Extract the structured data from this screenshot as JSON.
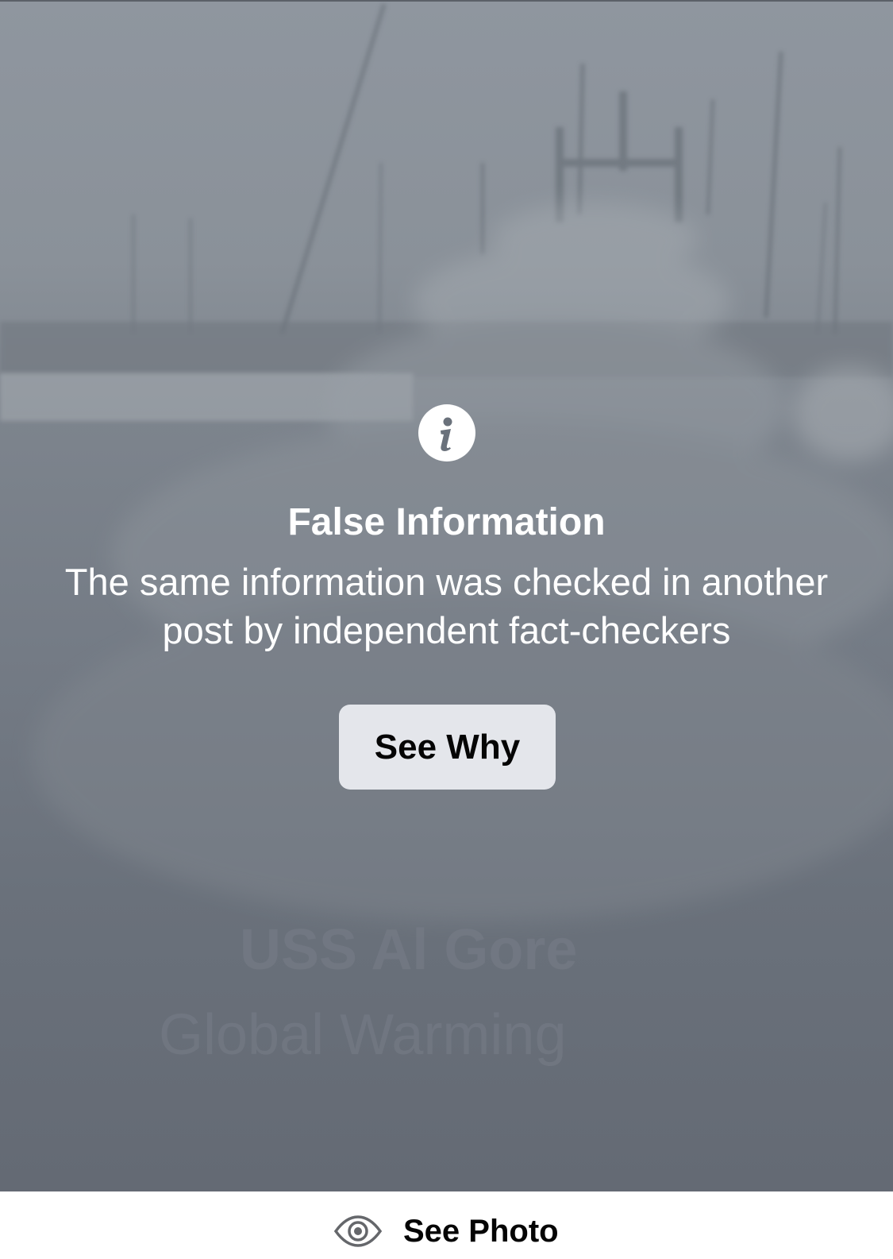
{
  "warning": {
    "icon": "info-icon",
    "title": "False Information",
    "description": "The same information was checked in another post by independent fact-checkers",
    "button_label": "See Why"
  },
  "photo": {
    "caption_line_1": "USS Al Gore",
    "caption_line_2": "Global Warming"
  },
  "footer": {
    "icon": "eye-icon",
    "label": "See Photo"
  }
}
